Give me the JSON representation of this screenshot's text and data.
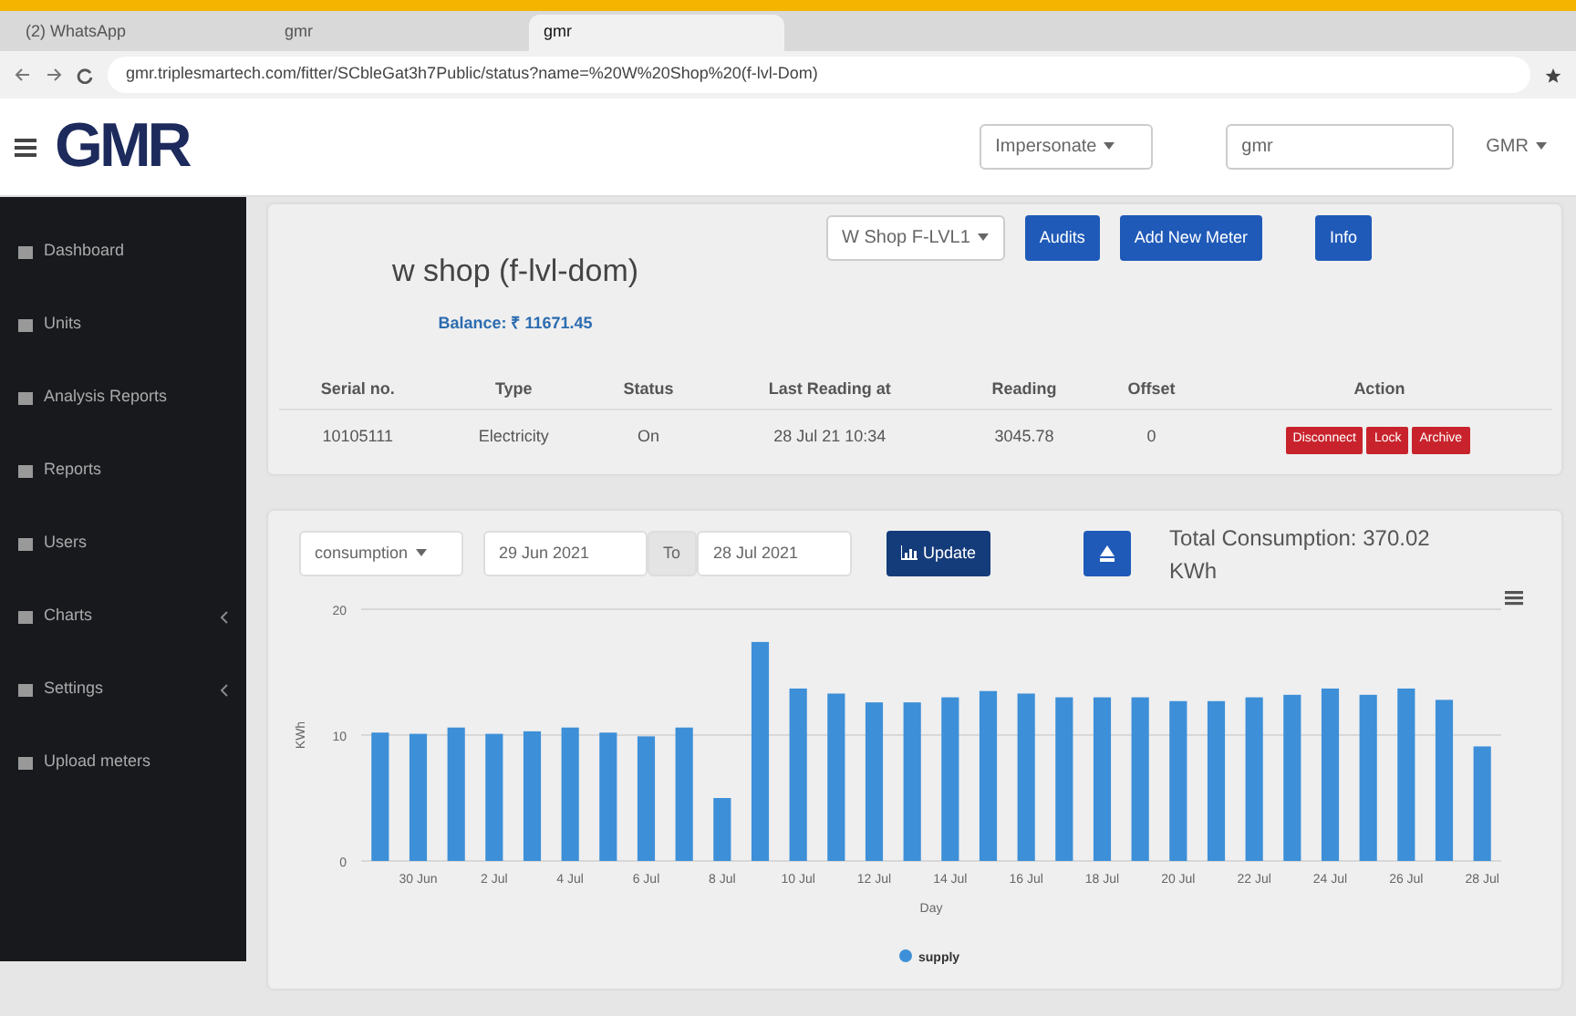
{
  "browser": {
    "tabs": [
      {
        "title": "(2) WhatsApp",
        "selected": false
      },
      {
        "title": "gmr",
        "selected": false
      },
      {
        "title": "gmr",
        "selected": true
      }
    ],
    "url": "gmr.triplesmartech.com/fitter/SCbleGat3h7Public/status?name=%20W%20Shop%20(f-lvl-Dom)"
  },
  "header": {
    "logo": "GMR",
    "impersonate": "Impersonate",
    "site": "gmr",
    "user": "GMR"
  },
  "sidebar": {
    "items": [
      {
        "label": "Dashboard",
        "submenu": false
      },
      {
        "label": "Units",
        "submenu": false
      },
      {
        "label": "Analysis Reports",
        "submenu": false
      },
      {
        "label": "Reports",
        "submenu": false
      },
      {
        "label": "Users",
        "submenu": false
      },
      {
        "label": "Charts",
        "submenu": true
      },
      {
        "label": "Settings",
        "submenu": true
      },
      {
        "label": "Upload meters",
        "submenu": false
      }
    ]
  },
  "unit": {
    "title": "w shop (f-lvl-dom)",
    "balance": "Balance: ₹ 11671.45",
    "meter_select": "W Shop F-LVL1",
    "buttons": [
      "Audits",
      "Add New Meter",
      "Info"
    ],
    "table": {
      "columns": [
        "Serial no.",
        "Type",
        "Status",
        "Last Reading at",
        "Reading",
        "Offset",
        "Action"
      ],
      "rows": [
        {
          "cells": [
            "10105111",
            "Electricity",
            "On",
            "28 Jul 21 10:34",
            "3045.78",
            "0"
          ],
          "actions": [
            "Disconnect",
            "Lock",
            "Archive"
          ]
        }
      ]
    }
  },
  "consumption": {
    "metric": "consumption",
    "from": "29 Jun 2021",
    "to_label": "To",
    "to": "28 Jul 2021",
    "update": "Update",
    "total": "Total Consumption: 370.02 KWh",
    "chart_data": {
      "type": "bar",
      "xlabel": "Day",
      "ylabel": "KWh",
      "categories": [
        null,
        "30 Jun",
        null,
        "2 Jul",
        null,
        "4 Jul",
        null,
        "6 Jul",
        null,
        "8 Jul",
        null,
        "10 Jul",
        null,
        "12 Jul",
        null,
        "14 Jul",
        null,
        "16 Jul",
        null,
        "18 Jul",
        null,
        "20 Jul",
        null,
        "22 Jul",
        null,
        "24 Jul",
        null,
        "26 Jul",
        null,
        "28 Jul"
      ],
      "series": [
        {
          "name": "supply",
          "color": "#3d8fd8",
          "values": [
            10.2,
            10.1,
            10.6,
            10.1,
            10.3,
            10.6,
            10.2,
            9.9,
            10.6,
            5.0,
            17.4,
            13.7,
            13.3,
            12.6,
            12.6,
            13.0,
            13.5,
            13.3,
            13.0,
            13.0,
            13.0,
            12.7,
            12.7,
            13.0,
            13.2,
            13.7,
            13.2,
            13.7,
            12.8,
            9.1
          ]
        }
      ],
      "ylim": [
        0,
        20
      ],
      "yticks": [
        0,
        10,
        20
      ]
    }
  }
}
